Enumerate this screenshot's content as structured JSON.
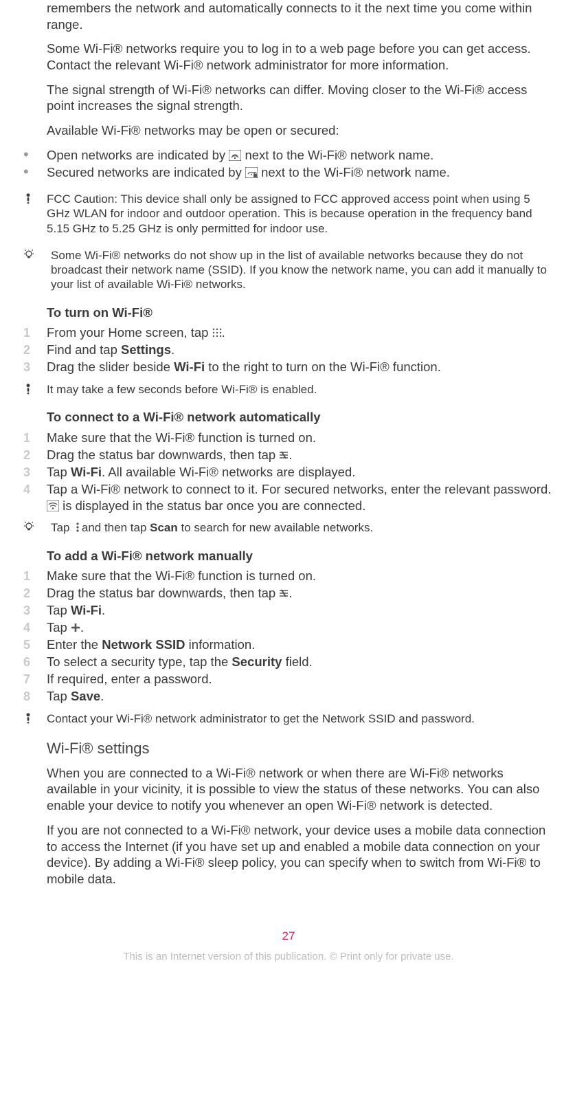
{
  "intro": {
    "p1": "remembers the network and automatically connects to it the next time you come within range.",
    "p2": "Some Wi-Fi® networks require you to log in to a web page before you can get access. Contact the relevant Wi-Fi® network administrator for more information.",
    "p3": "The signal strength of Wi-Fi® networks can differ. Moving closer to the Wi-Fi® access point increases the signal strength.",
    "p4": "Available Wi-Fi® networks may be open or secured:"
  },
  "bullets": {
    "open_pre": "Open networks are indicated by ",
    "open_post": " next to the Wi-Fi® network name.",
    "secured_pre": "Secured networks are indicated by ",
    "secured_post": " next to the Wi-Fi® network name."
  },
  "note_fcc": "FCC Caution: This device shall only be assigned to FCC approved access point when using 5 GHz WLAN for indoor and outdoor operation. This is because operation in the frequency band 5.15 GHz to 5.25 GHz is only permitted for indoor use.",
  "tip_hidden": "Some Wi-Fi® networks do not show up in the list of available networks because they do not broadcast their network name (SSID). If you know the network name, you can add it manually to your list of available Wi-Fi® networks.",
  "turn_on": {
    "heading": "To turn on Wi-Fi®",
    "step1_pre": "From your Home screen, tap ",
    "step1_post": ".",
    "step2_pre": "Find and tap ",
    "step2_bold": "Settings",
    "step2_post": ".",
    "step3_pre": "Drag the slider beside ",
    "step3_bold": "Wi-Fi",
    "step3_post": " to the right to turn on the Wi-Fi® function.",
    "note": "It may take a few seconds before Wi-Fi® is enabled."
  },
  "connect_auto": {
    "heading": "To connect to a Wi-Fi® network automatically",
    "step1": "Make sure that the Wi-Fi® function is turned on.",
    "step2_pre": "Drag the status bar downwards, then tap ",
    "step2_post": ".",
    "step3_pre": "Tap ",
    "step3_bold": "Wi-Fi",
    "step3_post": ". All available Wi-Fi® networks are displayed.",
    "step4_pre": "Tap a Wi-Fi® network to connect to it. For secured networks, enter the relevant password. ",
    "step4_post": " is displayed in the status bar once you are connected.",
    "tip_pre": "Tap ",
    "tip_mid": " and then tap ",
    "tip_bold": "Scan",
    "tip_post": " to search for new available networks."
  },
  "add_manual": {
    "heading": "To add a Wi-Fi® network manually",
    "step1": "Make sure that the Wi-Fi® function is turned on.",
    "step2_pre": "Drag the status bar downwards, then tap ",
    "step2_post": ".",
    "step3_pre": "Tap ",
    "step3_bold": "Wi-Fi",
    "step3_post": ".",
    "step4_pre": "Tap ",
    "step4_post": ".",
    "step5_pre": "Enter the ",
    "step5_bold": "Network SSID",
    "step5_post": " information.",
    "step6_pre": "To select a security type, tap the ",
    "step6_bold": "Security",
    "step6_post": " field.",
    "step7": "If required, enter a password.",
    "step8_pre": "Tap ",
    "step8_bold": "Save",
    "step8_post": ".",
    "note": "Contact your Wi-Fi® network administrator to get the Network SSID and password."
  },
  "wifi_settings": {
    "heading": "Wi-Fi® settings",
    "p1": "When you are connected to a Wi-Fi® network or when there are Wi-Fi® networks available in your vicinity, it is possible to view the status of these networks. You can also enable your device to notify you whenever an open Wi-Fi® network is detected.",
    "p2": "If you are not connected to a Wi-Fi® network, your device uses a mobile data connection to access the Internet (if you have set up and enabled a mobile data connection on your device). By adding a Wi-Fi® sleep policy, you can specify when to switch from Wi-Fi® to mobile data."
  },
  "page_number": "27",
  "footer": "This is an Internet version of this publication. © Print only for private use."
}
